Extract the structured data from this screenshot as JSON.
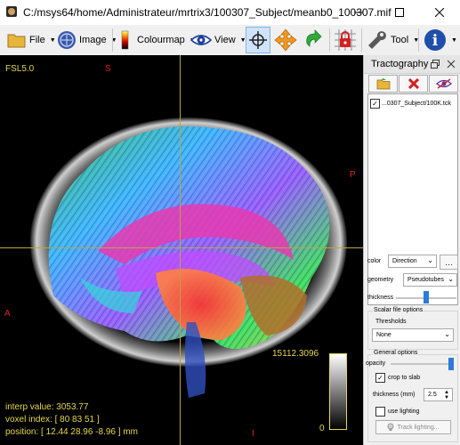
{
  "window": {
    "title": "C:/msys64/home/Administrateur/mrtrix3/100307_Subject/meanb0_100307.mif"
  },
  "toolbar": {
    "file_label": "File",
    "image_label": "Image",
    "colourmap_label": "Colourmap",
    "view_label": "View",
    "tool_label": "Tool"
  },
  "overlay": {
    "top_left": "FSL5.0",
    "orient_top": "S",
    "orient_right": "P",
    "orient_left": "A",
    "orient_bottom": "I",
    "colorbar_max": "15112.3096",
    "colorbar_min": "0",
    "interp_value": "interp value: 3053.77",
    "voxel_index": "voxel index: [ 80 83 51 ]",
    "position": "position: [ 12.44 28.96 -8.96 ] mm"
  },
  "panel": {
    "title": "Tractography",
    "tracks": [
      {
        "name": "...0307_Subject/100K.tck",
        "checked": true
      }
    ],
    "color_label": "color",
    "color_value": "Direction",
    "geometry_label": "geometry",
    "geometry_value": "Pseudotubes",
    "thickness_label": "thickness",
    "scalar_group": "Scalar file options",
    "thresholds_label": "Thresholds",
    "thresholds_value": "None",
    "general_group": "General options",
    "opacity_label": "opacity",
    "crop_label": "crop to slab",
    "slab_label": "thickness (mm)",
    "slab_value": "2.5",
    "lighting_label": "use lighting",
    "track_lighting_label": "Track lighting..."
  },
  "colors": {
    "overlay_text": "#e6d84a",
    "orient": "#e02020",
    "accent": "#2d7bd8"
  }
}
